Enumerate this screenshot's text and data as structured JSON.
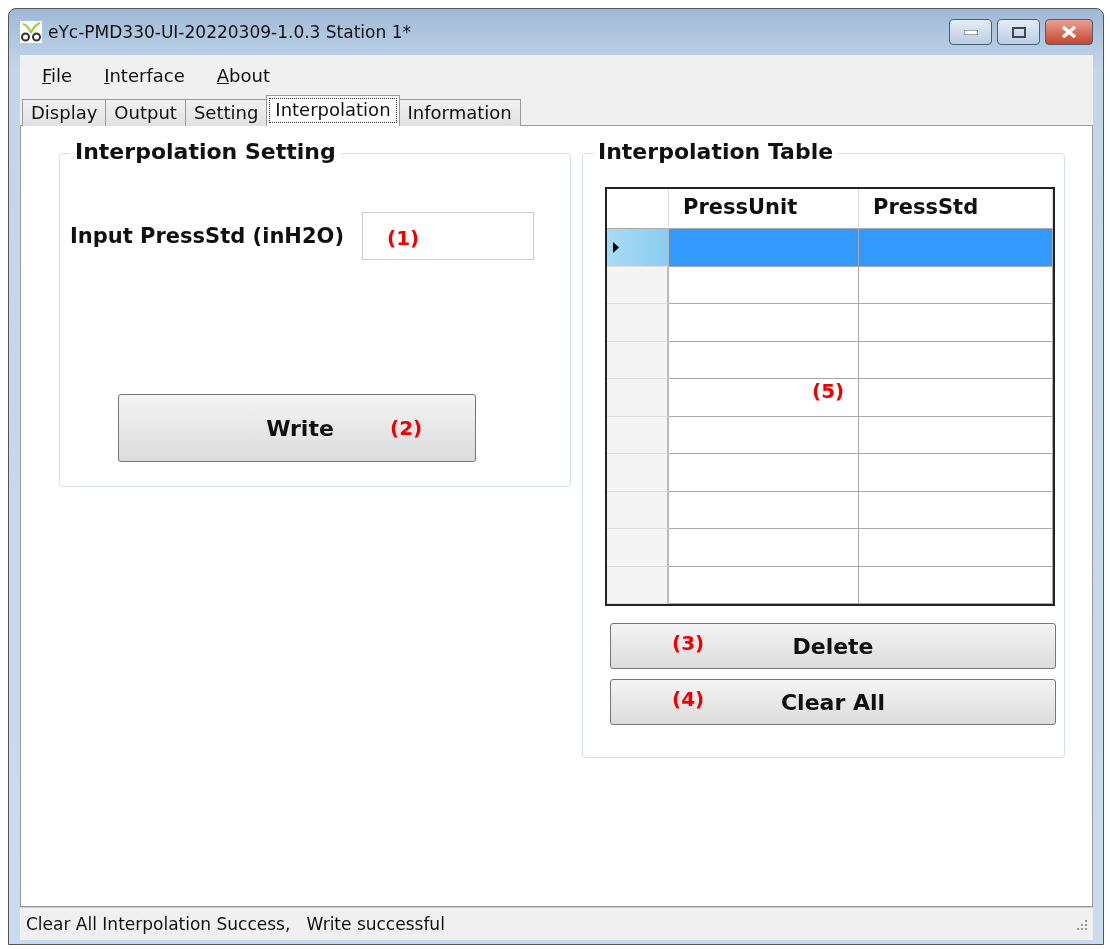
{
  "window": {
    "title": "eYc-PMD330-UI-20220309-1.0.3  Station 1*"
  },
  "menu": [
    {
      "label": "File"
    },
    {
      "label": "Interface"
    },
    {
      "label": "About"
    }
  ],
  "tabs": [
    {
      "label": "Display",
      "selected": false
    },
    {
      "label": "Output",
      "selected": false
    },
    {
      "label": "Setting",
      "selected": false
    },
    {
      "label": "Interpolation",
      "selected": true
    },
    {
      "label": "Information",
      "selected": false
    }
  ],
  "interpolation_setting": {
    "title": "Interpolation Setting",
    "field_label": "Input PressStd (inH2O)",
    "field_annotation": "(1)",
    "write_button": "Write",
    "write_annotation": "(2)"
  },
  "interpolation_table": {
    "title": "Interpolation Table",
    "columns": [
      "PressUnit",
      "PressStd"
    ],
    "annotation": "(5)",
    "rows": [
      {
        "selected": true
      },
      {
        "selected": false
      },
      {
        "selected": false
      },
      {
        "selected": false
      },
      {
        "selected": false
      },
      {
        "selected": false
      },
      {
        "selected": false
      },
      {
        "selected": false
      },
      {
        "selected": false
      },
      {
        "selected": false
      }
    ],
    "buttons": [
      {
        "label": "Delete",
        "annotation": "(3)"
      },
      {
        "label": "Clear All",
        "annotation": "(4)"
      }
    ]
  },
  "status_bar": {
    "text": "Clear All Interpolation Success,   Write successful"
  }
}
